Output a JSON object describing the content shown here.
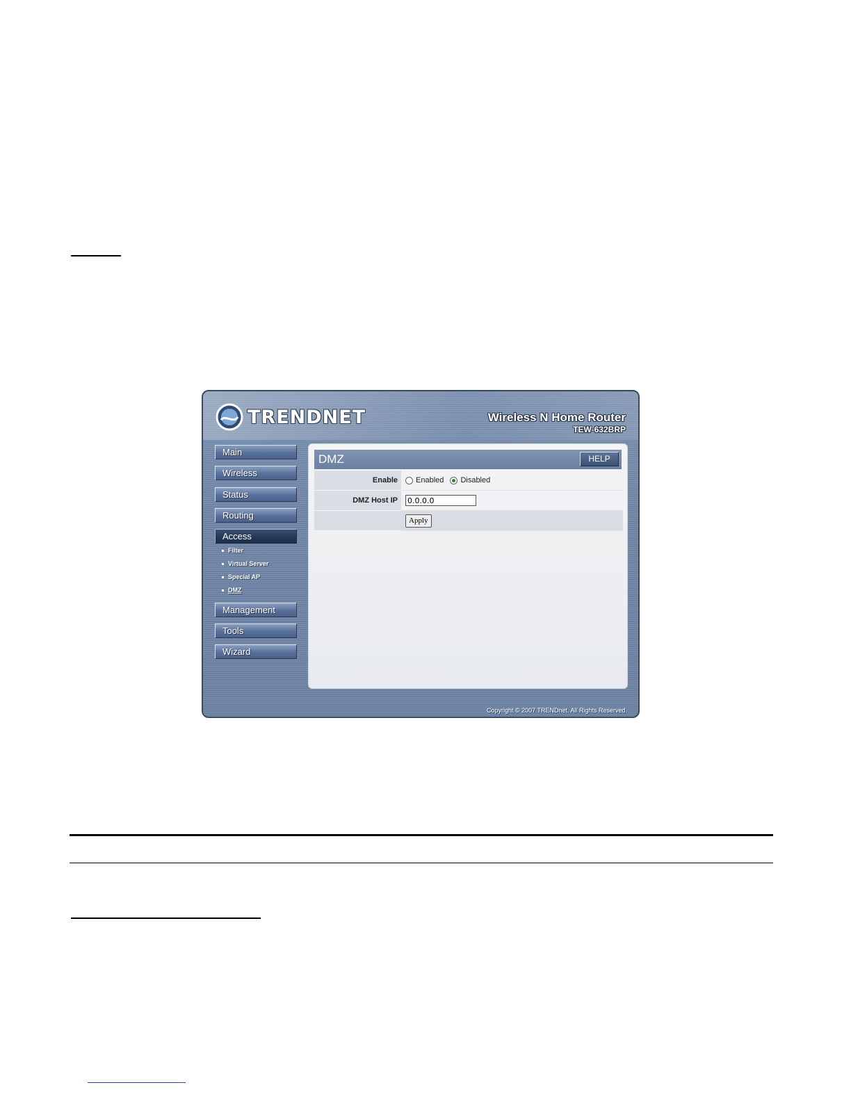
{
  "router": {
    "brand": "TRENDNET",
    "product_name": "Wireless N Home Router",
    "product_model": "TEW-632BRP",
    "copyright": "Copyright © 2007 TRENDnet. All Rights Reserved.",
    "nav": [
      {
        "label": "Main"
      },
      {
        "label": "Wireless"
      },
      {
        "label": "Status"
      },
      {
        "label": "Routing"
      },
      {
        "label": "Access"
      },
      {
        "label": "Management"
      },
      {
        "label": "Tools"
      },
      {
        "label": "Wizard"
      }
    ],
    "sub_nav": [
      {
        "label": "Filter"
      },
      {
        "label": "Virtual Server"
      },
      {
        "label": "Special AP"
      },
      {
        "label": "DMZ"
      }
    ],
    "panel": {
      "title": "DMZ",
      "help_label": "HELP",
      "enable_label": "Enable",
      "enabled_option": "Enabled",
      "disabled_option": "Disabled",
      "host_ip_label": "DMZ Host IP",
      "host_ip_value": "0.0.0.0",
      "apply_label": "Apply"
    }
  }
}
